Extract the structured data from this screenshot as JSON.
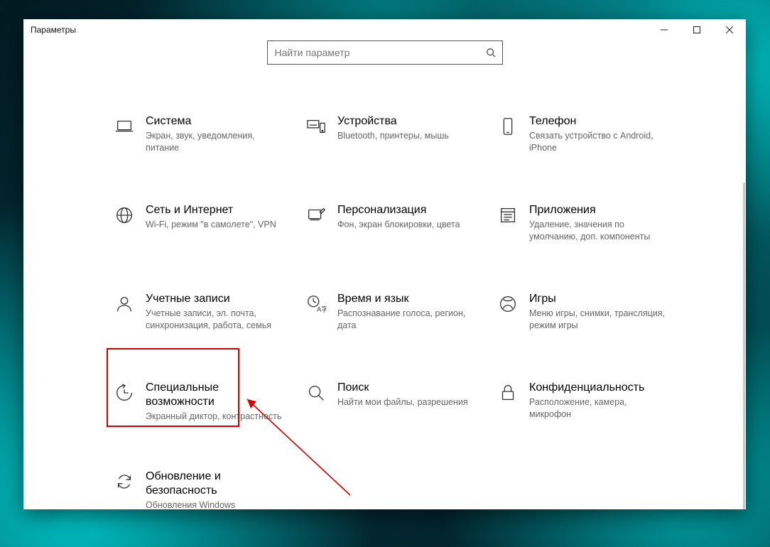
{
  "window": {
    "title": "Параметры"
  },
  "search": {
    "placeholder": "Найти параметр"
  },
  "tiles": [
    {
      "title": "Система",
      "desc": "Экран, звук, уведомления, питание"
    },
    {
      "title": "Устройства",
      "desc": "Bluetooth, принтеры, мышь"
    },
    {
      "title": "Телефон",
      "desc": "Связать устройство с Android, iPhone"
    },
    {
      "title": "Сеть и Интернет",
      "desc": "Wi-Fi, режим \"в самолете\", VPN"
    },
    {
      "title": "Персонализация",
      "desc": "Фон, экран блокировки, цвета"
    },
    {
      "title": "Приложения",
      "desc": "Удаление, значения по умолчанию, доп. компоненты"
    },
    {
      "title": "Учетные записи",
      "desc": "Учетные записи, эл. почта, синхронизация, работа, семья"
    },
    {
      "title": "Время и язык",
      "desc": "Распознавание голоса, регион, дата"
    },
    {
      "title": "Игры",
      "desc": "Меню игры, снимки, трансляция, режим игры"
    },
    {
      "title": "Специальные возможности",
      "desc": "Экранный диктор, контрастность"
    },
    {
      "title": "Поиск",
      "desc": "Найти мои файлы, разрешения"
    },
    {
      "title": "Конфиденциальность",
      "desc": "Расположение, камера, микрофон"
    },
    {
      "title": "Обновление и безопасность",
      "desc": "Обновления Windows"
    }
  ]
}
